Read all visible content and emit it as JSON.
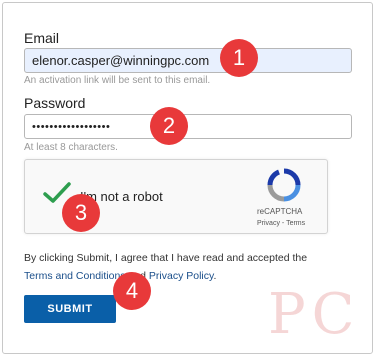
{
  "form": {
    "email_label": "Email",
    "email_value": "elenor.casper@winningpc.com",
    "email_hint": "An activation link will be sent to this email.",
    "password_label": "Password",
    "password_value": "••••••••••••••••••",
    "password_hint": "At least 8 characters.",
    "captcha": {
      "label": "I'm not a robot",
      "brand": "reCAPTCHA",
      "privacy": "Privacy",
      "separator": " - ",
      "terms": "Terms",
      "checked": true
    },
    "terms_text_start": "By clicking Submit, I agree that I have read and accepted the",
    "terms_link": "Terms and Conditions",
    "terms_and": " and ",
    "privacy_link": "Privacy Policy",
    "terms_end": ".",
    "submit_label": "SUBMIT"
  },
  "annotations": [
    "1",
    "2",
    "3",
    "4"
  ],
  "watermark": "PC",
  "colors": {
    "submit_bg": "#0a5fa8",
    "badge": "#e8393a",
    "check": "#2e9e4f",
    "link": "#1a4e8a"
  }
}
